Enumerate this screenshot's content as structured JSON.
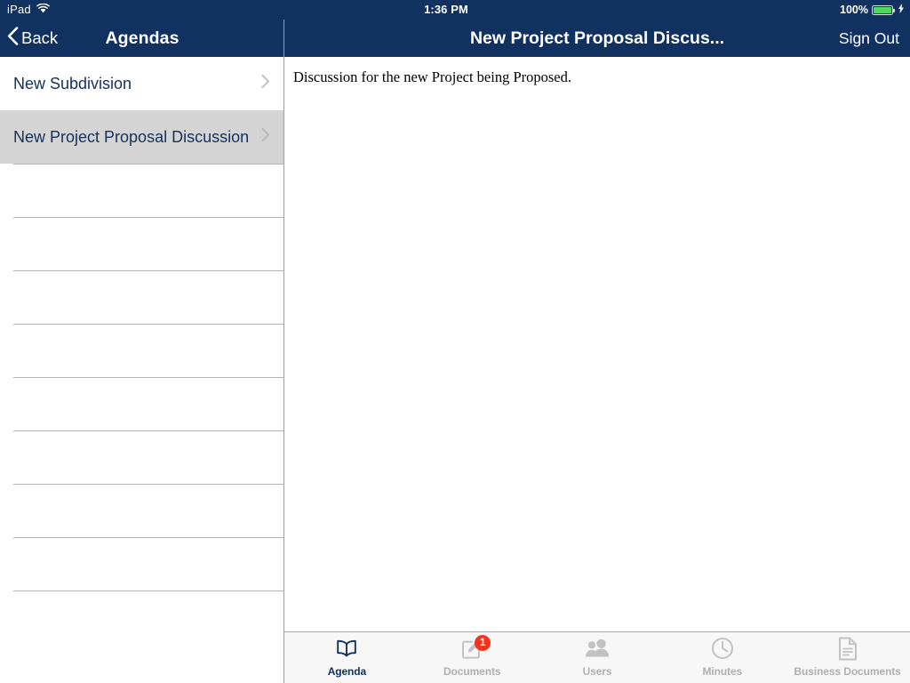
{
  "status_bar": {
    "device": "iPad",
    "wifi_icon": "wifi-icon",
    "time": "1:36 PM",
    "battery_percent": "100%",
    "battery_icon": "battery-icon",
    "charging_icon": "lightning-bolt-icon"
  },
  "colors": {
    "navbar_navy": "#113160",
    "accent_navy": "#14305c",
    "selected_row": "#d4d4d4",
    "badge_red": "#f4341f",
    "battery_green": "#4cd964",
    "tabbar_bg": "#f7f7f7",
    "tab_inactive": "#b0b0b0"
  },
  "left_pane": {
    "back_label": "Back",
    "back_icon": "chevron-left-icon",
    "title": "Agendas",
    "rows": [
      {
        "label": "New Subdivision",
        "selected": false,
        "chevron": "chevron-right-icon"
      },
      {
        "label": "New Project Proposal Discussion",
        "selected": true,
        "chevron": "chevron-right-icon"
      }
    ],
    "empty_row_count": 9
  },
  "right_pane": {
    "title": "New Project Proposal Discus...",
    "sign_out_label": "Sign Out",
    "body_text": "Discussion for the new Project being Proposed."
  },
  "tab_bar": {
    "tabs": [
      {
        "label": "Agenda",
        "icon": "book-icon",
        "active": true,
        "badge": null
      },
      {
        "label": "Documents",
        "icon": "compose-icon",
        "active": false,
        "badge": "1"
      },
      {
        "label": "Users",
        "icon": "users-icon",
        "active": false,
        "badge": null
      },
      {
        "label": "Minutes",
        "icon": "clock-icon",
        "active": false,
        "badge": null
      },
      {
        "label": "Business Documents",
        "icon": "document-icon",
        "active": false,
        "badge": null
      }
    ]
  }
}
